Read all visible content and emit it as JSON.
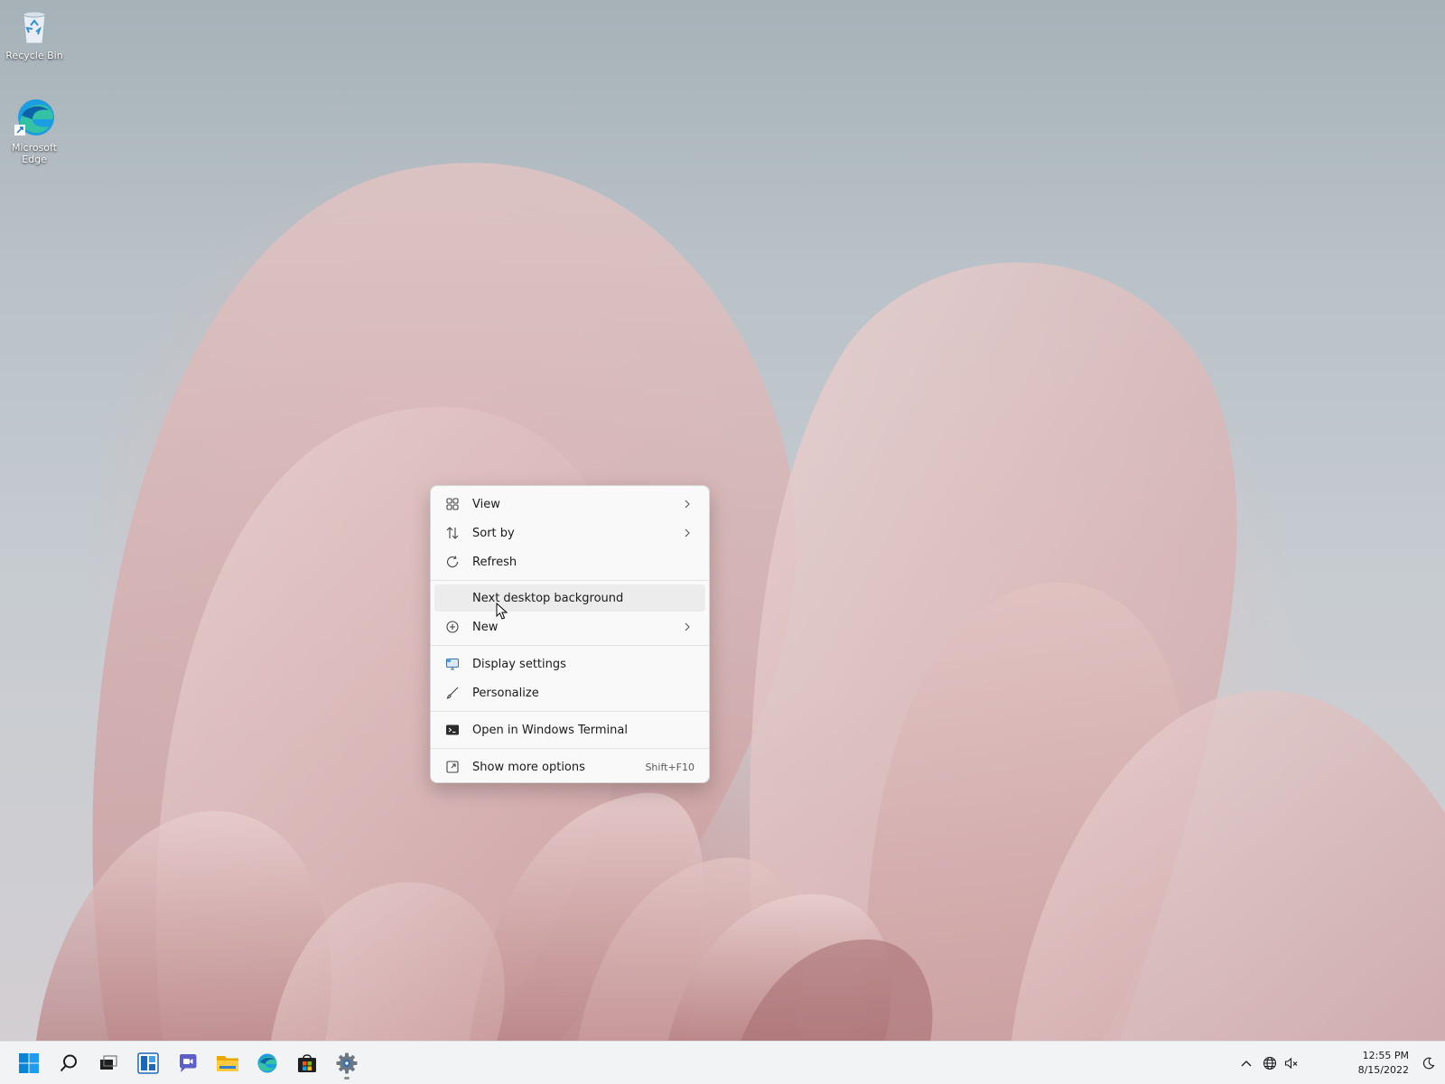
{
  "desktop": {
    "icons": [
      {
        "label": "Recycle Bin",
        "icon": "recycle-bin-icon"
      },
      {
        "label": "Microsoft Edge",
        "icon": "edge-icon"
      }
    ]
  },
  "context_menu": {
    "items": [
      {
        "label": "View",
        "icon": "grid-view-icon",
        "submenu": true
      },
      {
        "label": "Sort by",
        "icon": "sort-icon",
        "submenu": true
      },
      {
        "label": "Refresh",
        "icon": "refresh-icon",
        "submenu": false
      },
      {
        "label": "Next desktop background",
        "icon": "",
        "submenu": false,
        "hovered": true
      },
      {
        "label": "New",
        "icon": "plus-circle-icon",
        "submenu": true
      },
      {
        "label": "Display settings",
        "icon": "display-icon",
        "submenu": false
      },
      {
        "label": "Personalize",
        "icon": "brush-icon",
        "submenu": false
      },
      {
        "label": "Open in Windows Terminal",
        "icon": "terminal-icon",
        "submenu": false
      },
      {
        "label": "Show more options",
        "icon": "more-options-icon",
        "submenu": false,
        "shortcut": "Shift+F10"
      }
    ]
  },
  "taskbar": {
    "apps": [
      "start-icon",
      "search-icon",
      "task-view-icon",
      "widgets-icon",
      "chat-icon",
      "file-explorer-icon",
      "edge-icon",
      "store-icon",
      "settings-icon"
    ],
    "tray": {
      "icons": [
        "chevron-up-icon",
        "network-icon",
        "volume-mute-icon"
      ],
      "time": "12:55 PM",
      "date": "8/15/2022"
    }
  },
  "colors": {
    "accent": "#0067c0",
    "menu_bg": "#f9f9f9",
    "taskbar_bg": "#f1f3f5"
  }
}
